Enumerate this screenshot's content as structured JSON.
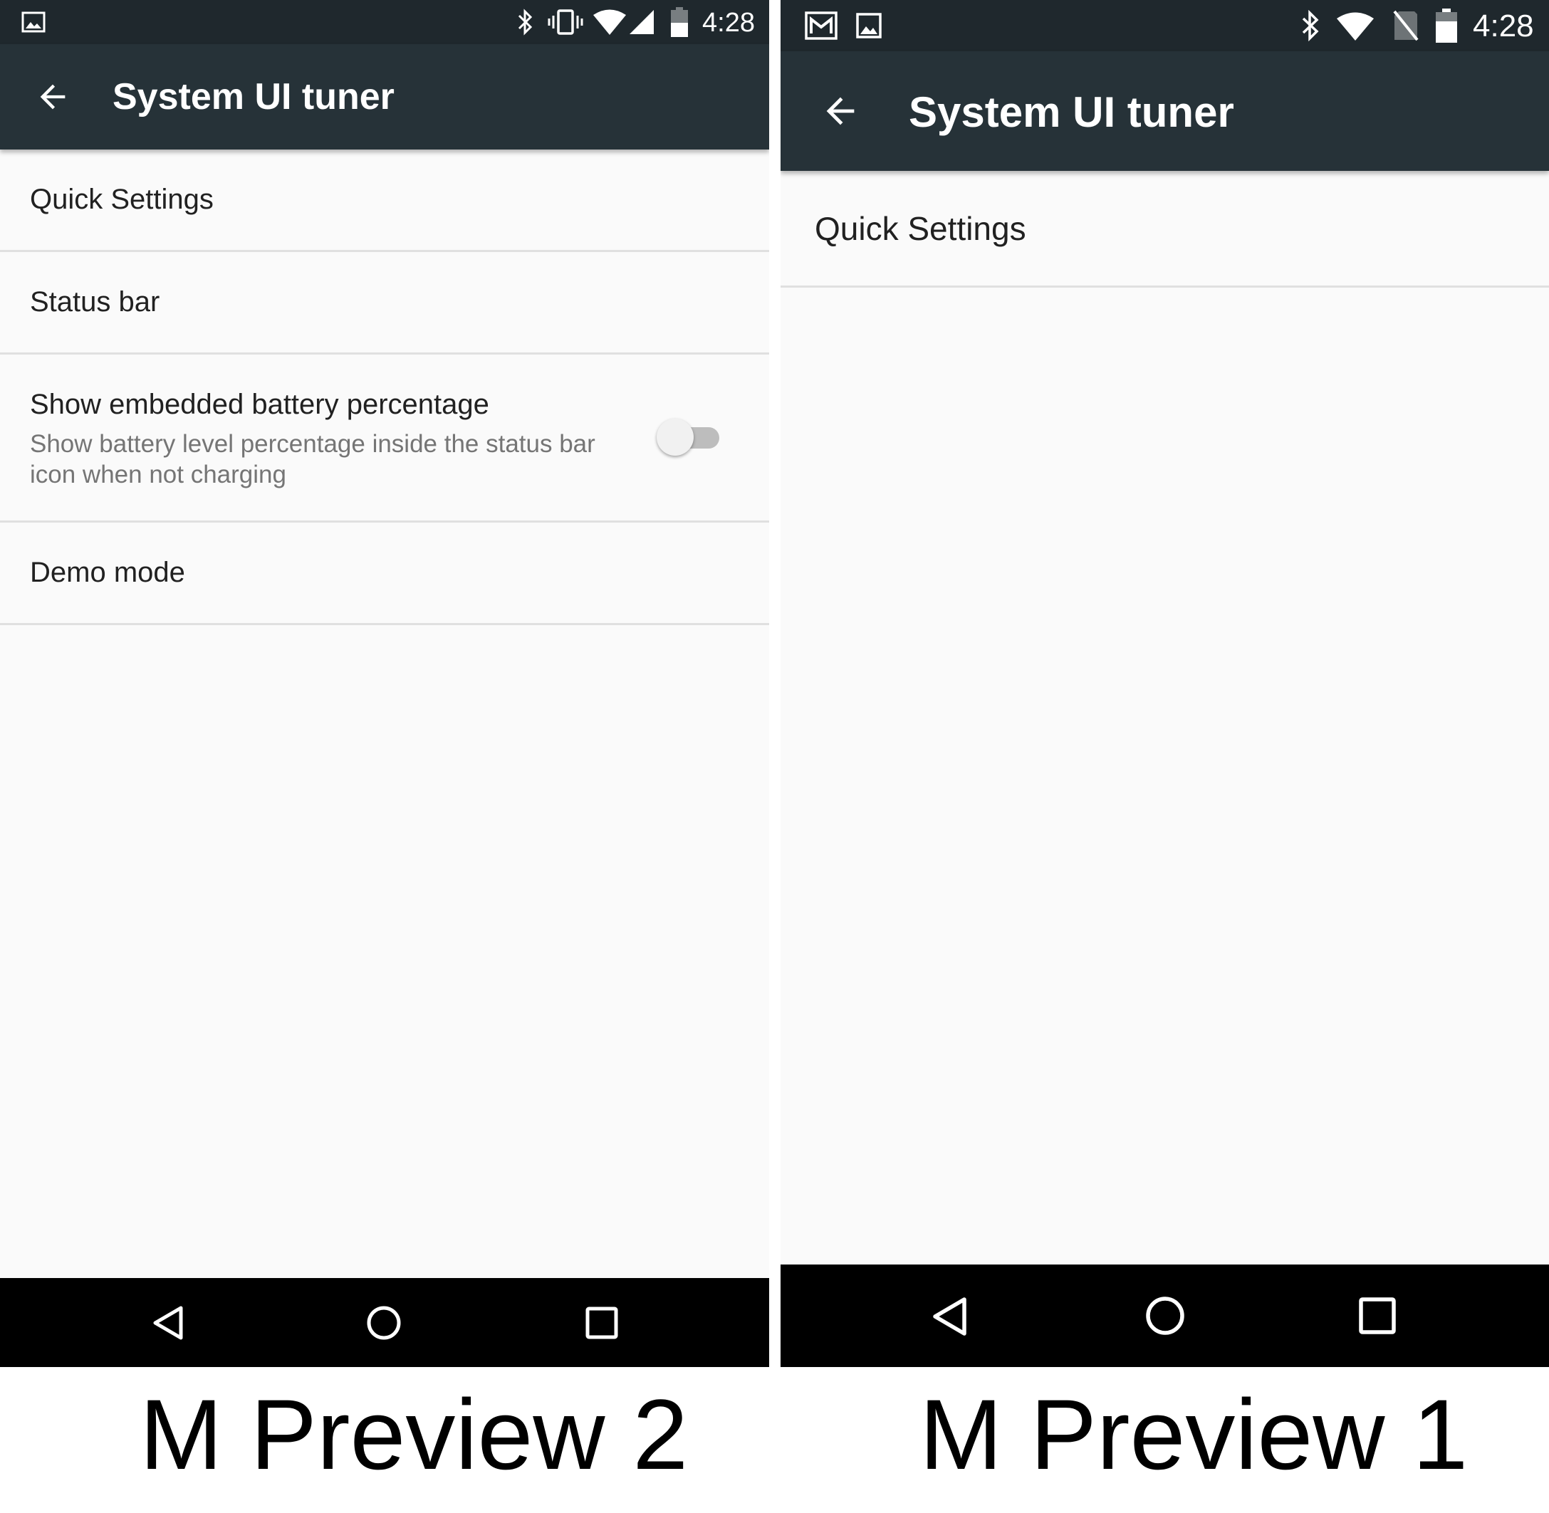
{
  "left_screen": {
    "status_bar": {
      "time": "4:28",
      "icons": [
        "image-notification-icon",
        "bluetooth-icon",
        "vibrate-icon",
        "wifi-icon",
        "cell-signal-icon",
        "battery-icon"
      ]
    },
    "app_bar": {
      "title": "System UI tuner",
      "back_icon": "arrow-back-icon"
    },
    "list": [
      {
        "title": "Quick Settings"
      },
      {
        "title": "Status bar"
      },
      {
        "title": "Show embedded battery percentage",
        "summary": "Show battery level percentage inside the status bar icon when not charging",
        "toggle": {
          "on": false
        }
      },
      {
        "title": "Demo mode"
      }
    ],
    "nav_bar": {
      "buttons": [
        "back-triangle-icon",
        "home-circle-icon",
        "recents-square-icon"
      ]
    },
    "caption": "M Preview 2"
  },
  "right_screen": {
    "status_bar": {
      "time": "4:28",
      "icons": [
        "gmail-icon",
        "image-notification-icon",
        "bluetooth-icon",
        "wifi-icon",
        "no-sim-icon",
        "battery-icon"
      ]
    },
    "app_bar": {
      "title": "System UI tuner",
      "back_icon": "arrow-back-icon"
    },
    "list": [
      {
        "title": "Quick Settings"
      }
    ],
    "nav_bar": {
      "buttons": [
        "back-triangle-icon",
        "home-circle-icon",
        "recents-square-icon"
      ]
    },
    "caption": "M Preview 1"
  },
  "colors": {
    "status_bar": "#1f282d",
    "app_bar": "#263238",
    "background": "#fafafa",
    "divider": "#e0e0e0",
    "primary_text": "#212121",
    "secondary_text": "#757575",
    "nav_bar": "#000000"
  }
}
